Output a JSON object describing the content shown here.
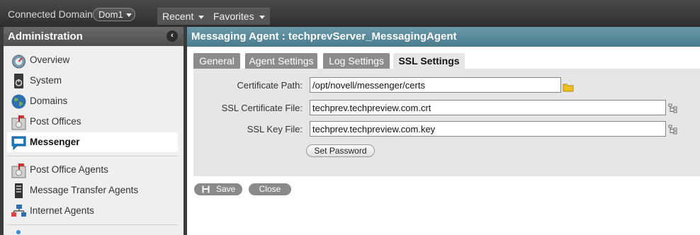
{
  "topbar": {
    "connected_domain_label": "Connected Domain:",
    "domain_value": "Dom1",
    "recent_label": "Recent",
    "favorites_label": "Favorites"
  },
  "sidebar": {
    "title": "Administration",
    "collapse_glyph": "‹",
    "items": [
      {
        "label": "Overview",
        "icon": "overview-icon"
      },
      {
        "label": "System",
        "icon": "system-icon"
      },
      {
        "label": "Domains",
        "icon": "domains-icon"
      },
      {
        "label": "Post Offices",
        "icon": "post-offices-icon"
      },
      {
        "label": "Messenger",
        "icon": "messenger-icon"
      },
      {
        "label": "Post Office Agents",
        "icon": "post-office-agents-icon"
      },
      {
        "label": "Message Transfer Agents",
        "icon": "message-transfer-agents-icon"
      },
      {
        "label": "Internet Agents",
        "icon": "internet-agents-icon"
      }
    ]
  },
  "main": {
    "title": "Messaging Agent : techprevServer_MessagingAgent",
    "tabs": [
      {
        "label": "General"
      },
      {
        "label": "Agent Settings"
      },
      {
        "label": "Log Settings"
      },
      {
        "label": "SSL Settings"
      }
    ],
    "form": {
      "certificate_path_label": "Certificate Path:",
      "certificate_path_value": "/opt/novell/messenger/certs",
      "ssl_cert_file_label": "SSL Certificate File:",
      "ssl_cert_file_value": "techprev.techpreview.com.crt",
      "ssl_key_file_label": "SSL Key File:",
      "ssl_key_file_value": "techprev.techpreview.com.key",
      "set_password_label": "Set Password"
    },
    "actions": {
      "save_label": "Save",
      "close_label": "Close"
    }
  },
  "colors": {
    "header_teal": "#4a7b8c",
    "folder_yellow": "#f0c020"
  }
}
